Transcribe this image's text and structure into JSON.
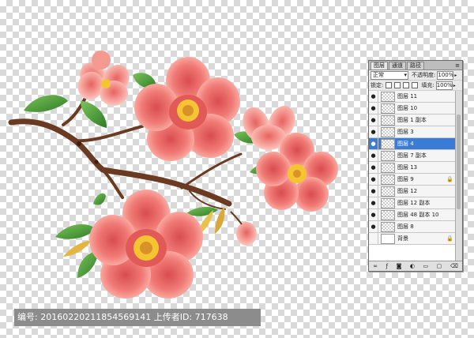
{
  "panel": {
    "tabs": [
      "图层",
      "通道",
      "路径"
    ],
    "menu_icon": "panel-menu-icon",
    "blend_mode": "正常",
    "opacity_label": "不透明度:",
    "opacity_value": "100%",
    "lock_label": "锁定:",
    "fill_label": "填充:",
    "fill_value": "100%",
    "layers": [
      {
        "name": "图层 11",
        "visible": true,
        "selected": false,
        "locked": false
      },
      {
        "name": "图层 10",
        "visible": true,
        "selected": false,
        "locked": false
      },
      {
        "name": "图层 1 副本",
        "visible": true,
        "selected": false,
        "locked": false
      },
      {
        "name": "图层 3",
        "visible": true,
        "selected": false,
        "locked": false
      },
      {
        "name": "图层 4",
        "visible": true,
        "selected": true,
        "locked": false
      },
      {
        "name": "图层 7 副本",
        "visible": true,
        "selected": false,
        "locked": false
      },
      {
        "name": "图层 13",
        "visible": true,
        "selected": false,
        "locked": false
      },
      {
        "name": "图层 9",
        "visible": true,
        "selected": false,
        "locked": true
      },
      {
        "name": "图层 12",
        "visible": true,
        "selected": false,
        "locked": false
      },
      {
        "name": "图层 12 副本",
        "visible": true,
        "selected": false,
        "locked": false
      },
      {
        "name": "图层 48 副本 10",
        "visible": true,
        "selected": false,
        "locked": false
      },
      {
        "name": "图层 8",
        "visible": true,
        "selected": false,
        "locked": false
      },
      {
        "name": "背景",
        "visible": false,
        "selected": false,
        "locked": true
      }
    ]
  },
  "watermark": {
    "id_label": "编号:",
    "id_value": "20160220211854569141",
    "uploader_label": "上传者ID:",
    "uploader_value": "717638"
  },
  "colors": {
    "petal": "#f07a76",
    "petal_light": "#ffc4b8",
    "stamen": "#f5c531",
    "leaf": "#3f9a34",
    "branch": "#6b3a22"
  }
}
